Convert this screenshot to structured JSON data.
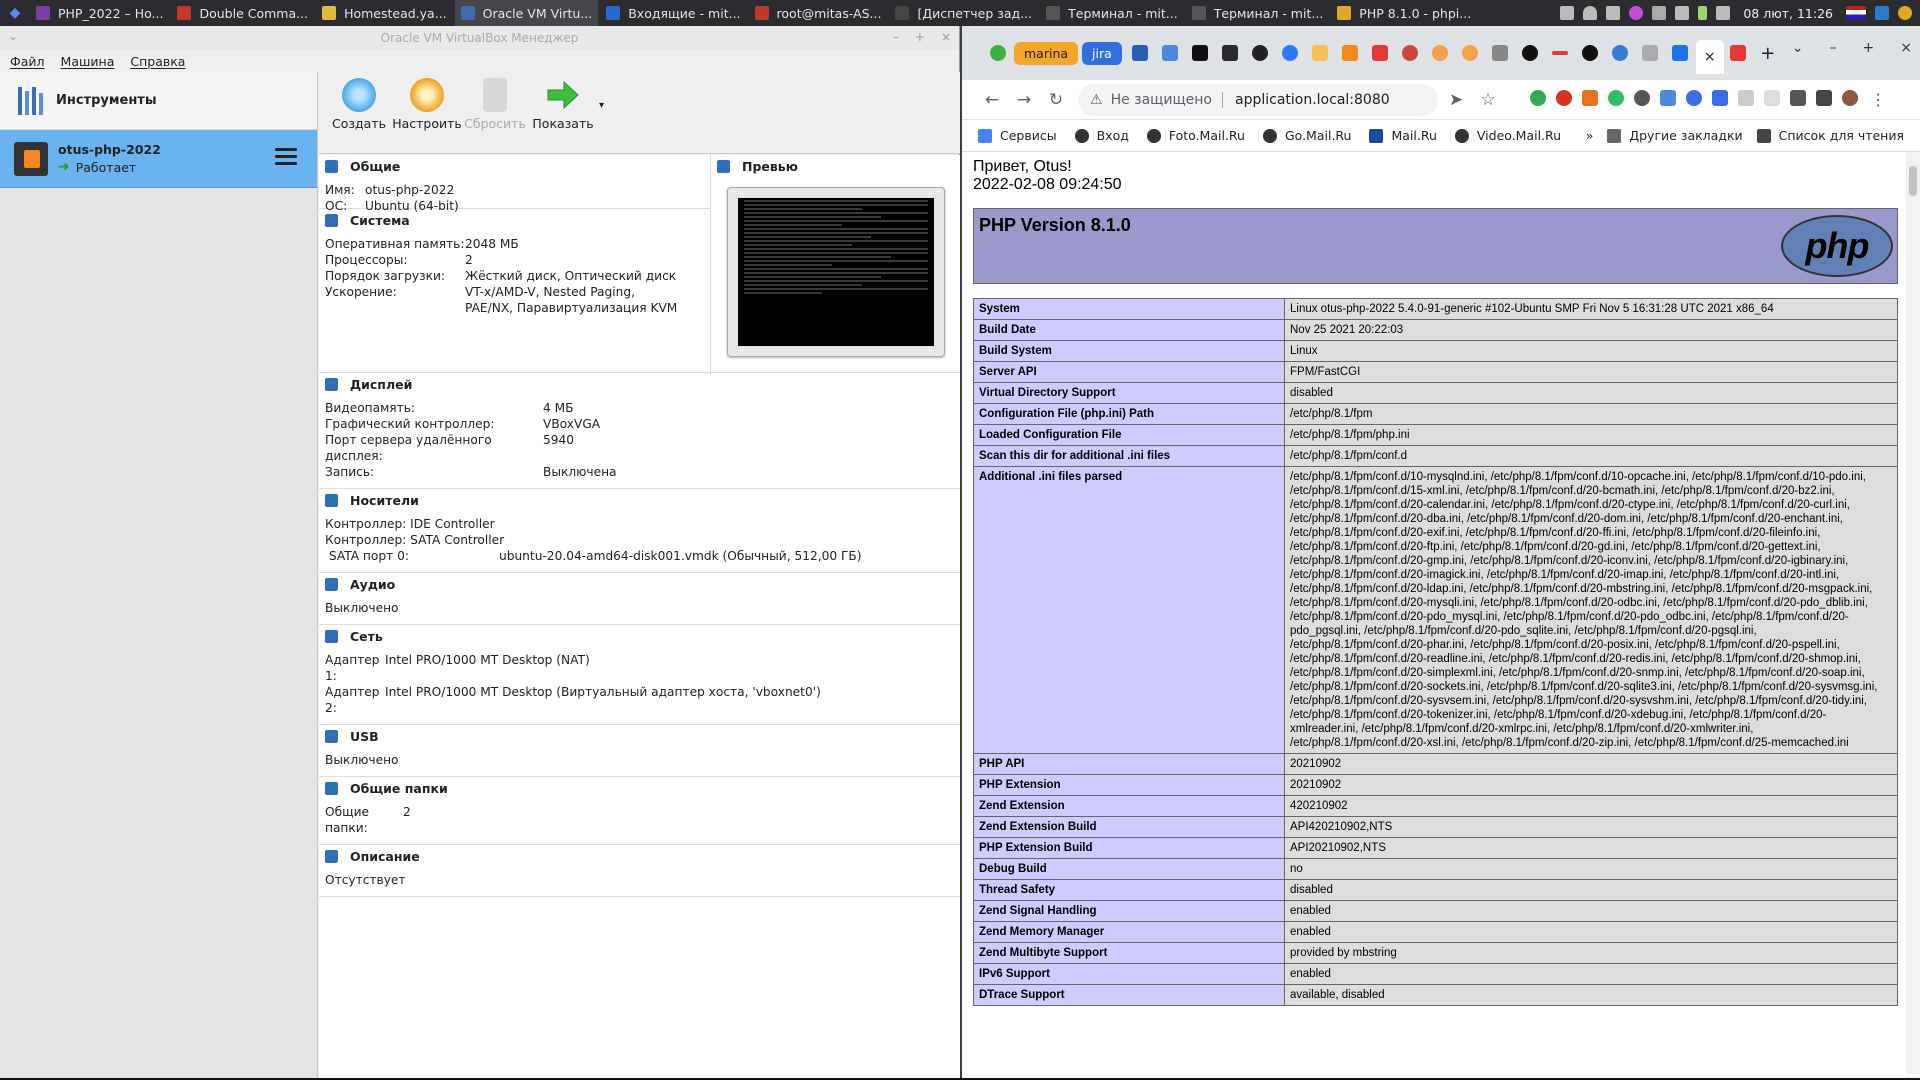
{
  "taskbar": {
    "tasks": [
      {
        "label": "PHP_2022 – Ho...",
        "color": "#7a3fa0"
      },
      {
        "label": "Double Comma...",
        "color": "#c0392b"
      },
      {
        "label": "Homestead.ya...",
        "color": "#e2b93b"
      },
      {
        "label": "Oracle VM Virtu...",
        "color": "#3c6db0"
      },
      {
        "label": "Входящие - mit...",
        "color": "#2a6ad0"
      },
      {
        "label": "root@mitas-AS...",
        "color": "#c0392b"
      },
      {
        "label": "[Диспетчер зад...",
        "color": "#444"
      },
      {
        "label": "Терминал - mit...",
        "color": "#555"
      },
      {
        "label": "Терминал - mit...",
        "color": "#555"
      },
      {
        "label": "PHP 8.1.0 - phpi...",
        "color": "#e4a52a"
      }
    ],
    "clock": "08 лют, 11:26"
  },
  "vbox": {
    "title": "Oracle VM VirtualBox Менеджер",
    "menu": [
      "Файл",
      "Машина",
      "Справка"
    ],
    "tools_label": "Инструменты",
    "vm": {
      "name": "otus-php-2022",
      "state": "Работает"
    },
    "toolbar": [
      {
        "label": "Создать",
        "color": "#4aa7e8",
        "disabled": false
      },
      {
        "label": "Настроить",
        "color": "#f0a020",
        "disabled": false
      },
      {
        "label": "Сбросить",
        "color": "#cfcfcf",
        "disabled": true
      },
      {
        "label": "Показать",
        "color": "#3cbf3c",
        "disabled": false
      }
    ],
    "general": {
      "title": "Общие",
      "rows": [
        [
          "Имя:",
          "otus-php-2022"
        ],
        [
          "ОС:",
          "Ubuntu (64-bit)"
        ]
      ]
    },
    "preview_title": "Превью",
    "system": {
      "title": "Система",
      "rows": [
        [
          "Оперативная память:",
          "2048 МБ"
        ],
        [
          "Процессоры:",
          "2"
        ],
        [
          "Порядок загрузки:",
          "Жёсткий диск, Оптический диск"
        ],
        [
          "Ускорение:",
          "VT-x/AMD-V, Nested Paging, PAE/NX, Паравиртуализация KVM"
        ]
      ]
    },
    "display": {
      "title": "Дисплей",
      "rows": [
        [
          "Видеопамять:",
          "4 МБ"
        ],
        [
          "Графический контроллер:",
          "VBoxVGA"
        ],
        [
          "Порт сервера удалённого дисплея:",
          "5940"
        ],
        [
          "Запись:",
          "Выключена"
        ]
      ]
    },
    "storage": {
      "title": "Носители",
      "lines": [
        "Контроллер: IDE Controller",
        "Контроллер: SATA Controller"
      ],
      "port_label": " SATA порт 0:",
      "port_value": "ubuntu-20.04-amd64-disk001.vmdk (Обычный, 512,00 ГБ)"
    },
    "audio": {
      "title": "Аудио",
      "value": "Выключено"
    },
    "network": {
      "title": "Сеть",
      "rows": [
        [
          "Адаптер 1:",
          "Intel PRO/1000 MT Desktop (NAT)"
        ],
        [
          "Адаптер 2:",
          "Intel PRO/1000 MT Desktop (Виртуальный адаптер хоста, 'vboxnet0')"
        ]
      ]
    },
    "usb": {
      "title": "USB",
      "value": "Выключено"
    },
    "shared": {
      "title": "Общие папки",
      "label": "Общие папки:",
      "value": "2"
    },
    "description": {
      "title": "Описание",
      "value": "Отсутствует"
    }
  },
  "browser": {
    "pinned_tabs": [
      {
        "label": "marina",
        "color": "#f4a52a"
      },
      {
        "label": "jira",
        "color": "#2f6fe0"
      }
    ],
    "insecure_label": "Не защищено",
    "url": "application.local:8080",
    "bookmarks": [
      "Сервисы",
      "Вход",
      "Foto.Mail.Ru",
      "Go.Mail.Ru",
      "Mail.Ru",
      "Video.Mail.Ru"
    ],
    "bookmarks_more": "»",
    "other_bookmarks": "Другие закладки",
    "reading_list": "Список для чтения"
  },
  "page": {
    "greeting": "Привет, Otus!",
    "timestamp": "2022-02-08 09:24:50",
    "php_version": "PHP Version 8.1.0",
    "logo_text": "php",
    "rows": [
      [
        "System",
        "Linux otus-php-2022 5.4.0-91-generic #102-Ubuntu SMP Fri Nov 5 16:31:28 UTC 2021 x86_64"
      ],
      [
        "Build Date",
        "Nov 25 2021 20:22:03"
      ],
      [
        "Build System",
        "Linux"
      ],
      [
        "Server API",
        "FPM/FastCGI"
      ],
      [
        "Virtual Directory Support",
        "disabled"
      ],
      [
        "Configuration File (php.ini) Path",
        "/etc/php/8.1/fpm"
      ],
      [
        "Loaded Configuration File",
        "/etc/php/8.1/fpm/php.ini"
      ],
      [
        "Scan this dir for additional .ini files",
        "/etc/php/8.1/fpm/conf.d"
      ],
      [
        "Additional .ini files parsed",
        "/etc/php/8.1/fpm/conf.d/10-mysqlnd.ini, /etc/php/8.1/fpm/conf.d/10-opcache.ini, /etc/php/8.1/fpm/conf.d/10-pdo.ini, /etc/php/8.1/fpm/conf.d/15-xml.ini, /etc/php/8.1/fpm/conf.d/20-bcmath.ini, /etc/php/8.1/fpm/conf.d/20-bz2.ini, /etc/php/8.1/fpm/conf.d/20-calendar.ini, /etc/php/8.1/fpm/conf.d/20-ctype.ini, /etc/php/8.1/fpm/conf.d/20-curl.ini, /etc/php/8.1/fpm/conf.d/20-dba.ini, /etc/php/8.1/fpm/conf.d/20-dom.ini, /etc/php/8.1/fpm/conf.d/20-enchant.ini, /etc/php/8.1/fpm/conf.d/20-exif.ini, /etc/php/8.1/fpm/conf.d/20-ffi.ini, /etc/php/8.1/fpm/conf.d/20-fileinfo.ini, /etc/php/8.1/fpm/conf.d/20-ftp.ini, /etc/php/8.1/fpm/conf.d/20-gd.ini, /etc/php/8.1/fpm/conf.d/20-gettext.ini, /etc/php/8.1/fpm/conf.d/20-gmp.ini, /etc/php/8.1/fpm/conf.d/20-iconv.ini, /etc/php/8.1/fpm/conf.d/20-igbinary.ini, /etc/php/8.1/fpm/conf.d/20-imagick.ini, /etc/php/8.1/fpm/conf.d/20-imap.ini, /etc/php/8.1/fpm/conf.d/20-intl.ini, /etc/php/8.1/fpm/conf.d/20-ldap.ini, /etc/php/8.1/fpm/conf.d/20-mbstring.ini, /etc/php/8.1/fpm/conf.d/20-msgpack.ini, /etc/php/8.1/fpm/conf.d/20-mysqli.ini, /etc/php/8.1/fpm/conf.d/20-odbc.ini, /etc/php/8.1/fpm/conf.d/20-pdo_dblib.ini, /etc/php/8.1/fpm/conf.d/20-pdo_mysql.ini, /etc/php/8.1/fpm/conf.d/20-pdo_odbc.ini, /etc/php/8.1/fpm/conf.d/20-pdo_pgsql.ini, /etc/php/8.1/fpm/conf.d/20-pdo_sqlite.ini, /etc/php/8.1/fpm/conf.d/20-pgsql.ini, /etc/php/8.1/fpm/conf.d/20-phar.ini, /etc/php/8.1/fpm/conf.d/20-posix.ini, /etc/php/8.1/fpm/conf.d/20-pspell.ini, /etc/php/8.1/fpm/conf.d/20-readline.ini, /etc/php/8.1/fpm/conf.d/20-redis.ini, /etc/php/8.1/fpm/conf.d/20-shmop.ini, /etc/php/8.1/fpm/conf.d/20-simplexml.ini, /etc/php/8.1/fpm/conf.d/20-snmp.ini, /etc/php/8.1/fpm/conf.d/20-soap.ini, /etc/php/8.1/fpm/conf.d/20-sockets.ini, /etc/php/8.1/fpm/conf.d/20-sqlite3.ini, /etc/php/8.1/fpm/conf.d/20-sysvmsg.ini, /etc/php/8.1/fpm/conf.d/20-sysvsem.ini, /etc/php/8.1/fpm/conf.d/20-sysvshm.ini, /etc/php/8.1/fpm/conf.d/20-tidy.ini, /etc/php/8.1/fpm/conf.d/20-tokenizer.ini, /etc/php/8.1/fpm/conf.d/20-xdebug.ini, /etc/php/8.1/fpm/conf.d/20-xmlreader.ini, /etc/php/8.1/fpm/conf.d/20-xmlrpc.ini, /etc/php/8.1/fpm/conf.d/20-xmlwriter.ini, /etc/php/8.1/fpm/conf.d/20-xsl.ini, /etc/php/8.1/fpm/conf.d/20-zip.ini, /etc/php/8.1/fpm/conf.d/25-memcached.ini"
      ],
      [
        "PHP API",
        "20210902"
      ],
      [
        "PHP Extension",
        "20210902"
      ],
      [
        "Zend Extension",
        "420210902"
      ],
      [
        "Zend Extension Build",
        "API420210902,NTS"
      ],
      [
        "PHP Extension Build",
        "API20210902,NTS"
      ],
      [
        "Debug Build",
        "no"
      ],
      [
        "Thread Safety",
        "disabled"
      ],
      [
        "Zend Signal Handling",
        "enabled"
      ],
      [
        "Zend Memory Manager",
        "enabled"
      ],
      [
        "Zend Multibyte Support",
        "provided by mbstring"
      ],
      [
        "IPv6 Support",
        "enabled"
      ],
      [
        "DTrace Support",
        "available, disabled"
      ]
    ]
  }
}
